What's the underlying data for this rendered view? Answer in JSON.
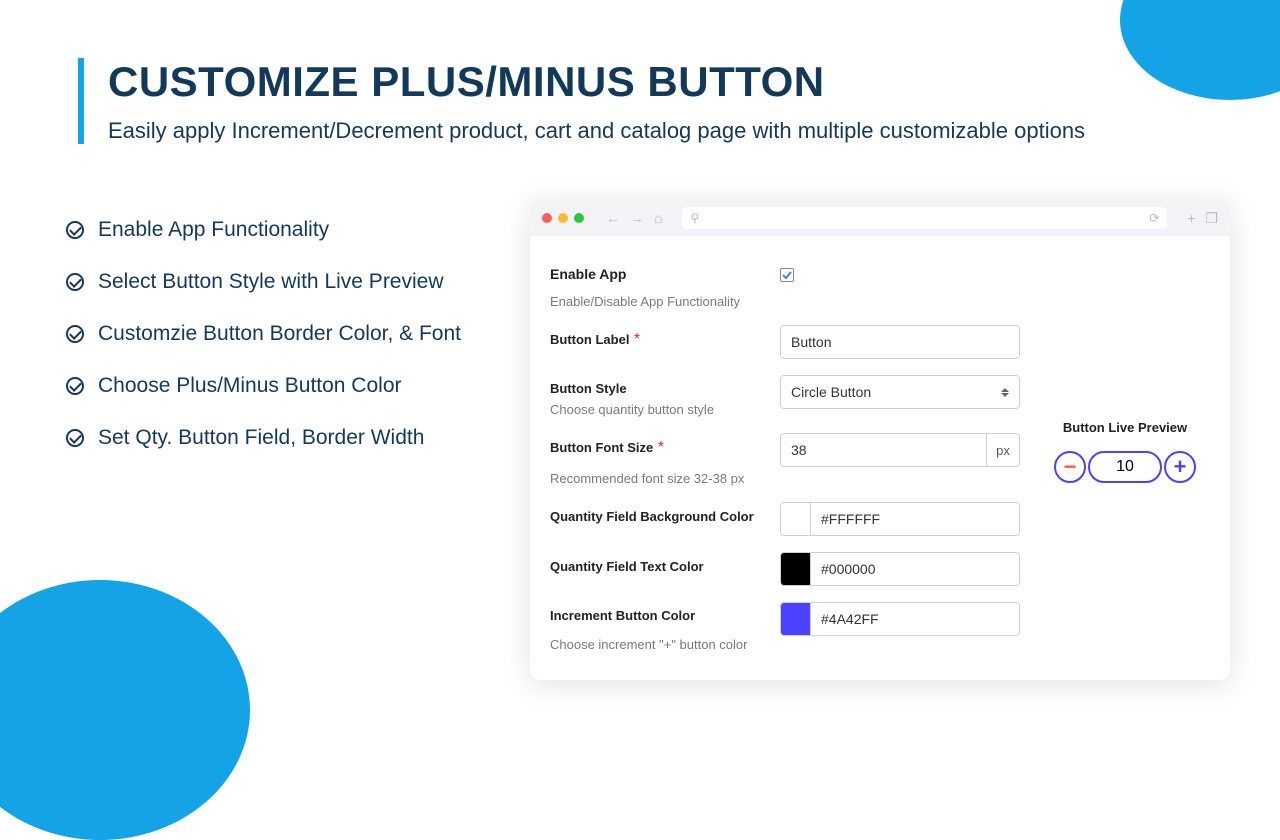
{
  "header": {
    "title": "CUSTOMIZE PLUS/MINUS BUTTON",
    "subtitle": "Easily apply Increment/Decrement product, cart and catalog page with multiple customizable options"
  },
  "features": [
    "Enable App Functionality",
    "Select Button Style with Live Preview",
    "Customzie Button Border Color, & Font",
    "Choose Plus/Minus Button Color",
    "Set Qty. Button Field, Border Width"
  ],
  "form": {
    "enable_app_label": "Enable App",
    "enable_app_hint": "Enable/Disable App Functionality",
    "enable_app_checked": true,
    "button_label_label": "Button Label",
    "button_label_value": "Button",
    "button_style_label": "Button Style",
    "button_style_hint": "Choose quantity button style",
    "button_style_value": "Circle Button",
    "font_size_label": "Button Font Size",
    "font_size_value": "38",
    "font_size_unit": "px",
    "font_size_hint": "Recommended font size 32-38 px",
    "qty_bg_label": "Quantity Field Background Color",
    "qty_bg_value": "#FFFFFF",
    "qty_text_label": "Quantity Field Text Color",
    "qty_text_value": "#000000",
    "increment_color_label": "Increment Button Color",
    "increment_color_value": "#4A42FF",
    "increment_color_hint": "Choose increment \"+\" button color"
  },
  "preview": {
    "title": "Button Live Preview",
    "value": "10",
    "minus_glyph": "−",
    "plus_glyph": "+"
  },
  "colors": {
    "qty_bg_swatch": "#FFFFFF",
    "qty_text_swatch": "#000000",
    "increment_swatch": "#4A42FF"
  }
}
